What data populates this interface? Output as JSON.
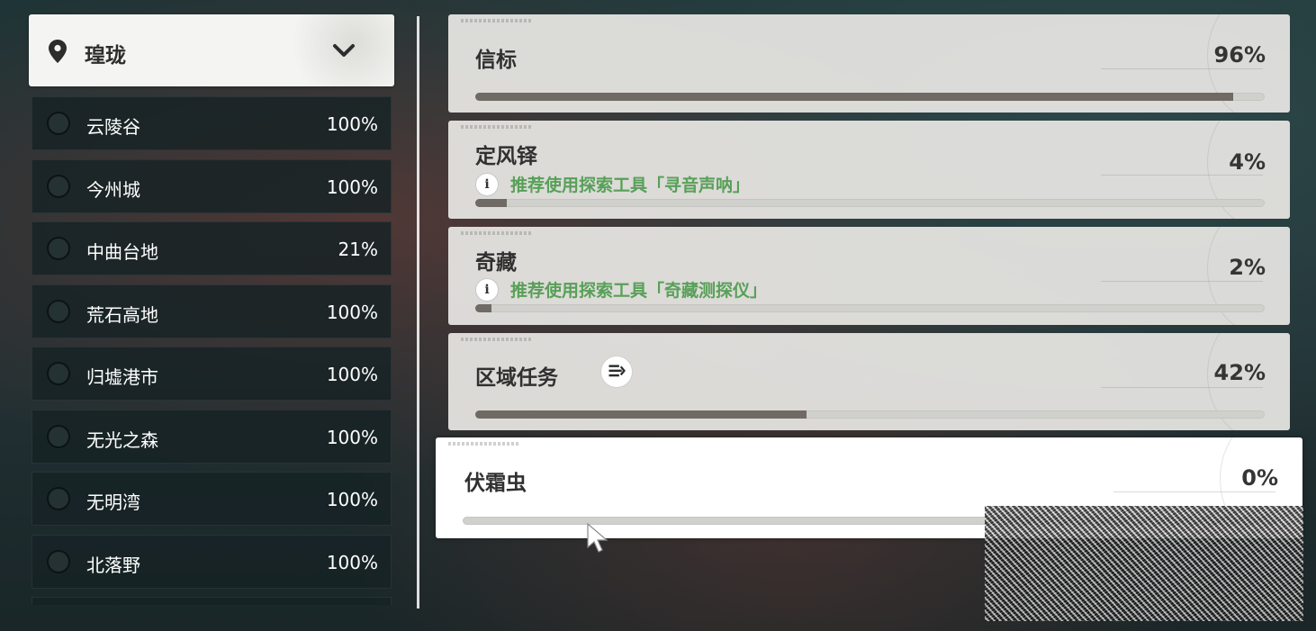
{
  "region": {
    "name": "瑝珑"
  },
  "subregions": [
    {
      "name": "云陵谷",
      "percent": "100%"
    },
    {
      "name": "今州城",
      "percent": "100%"
    },
    {
      "name": "中曲台地",
      "percent": "21%"
    },
    {
      "name": "荒石高地",
      "percent": "100%"
    },
    {
      "name": "归墟港市",
      "percent": "100%"
    },
    {
      "name": "无光之森",
      "percent": "100%"
    },
    {
      "name": "无明湾",
      "percent": "100%"
    },
    {
      "name": "北落野",
      "percent": "100%"
    }
  ],
  "categories": [
    {
      "title": "信标",
      "percent": "96%",
      "progress": 0.96
    },
    {
      "title": "定风铎",
      "percent": "4%",
      "progress": 0.04,
      "hint": "推荐使用探索工具「寻音声呐」"
    },
    {
      "title": "奇藏",
      "percent": "2%",
      "progress": 0.02,
      "hint": "推荐使用探索工具「奇藏测探仪」"
    },
    {
      "title": "区域任务",
      "percent": "42%",
      "progress": 0.42
    },
    {
      "title": "伏霜虫",
      "percent": "0%",
      "progress": 0.0
    }
  ],
  "colors": {
    "progress_fill": "#6f6a63",
    "hint_green": "#58a058"
  }
}
